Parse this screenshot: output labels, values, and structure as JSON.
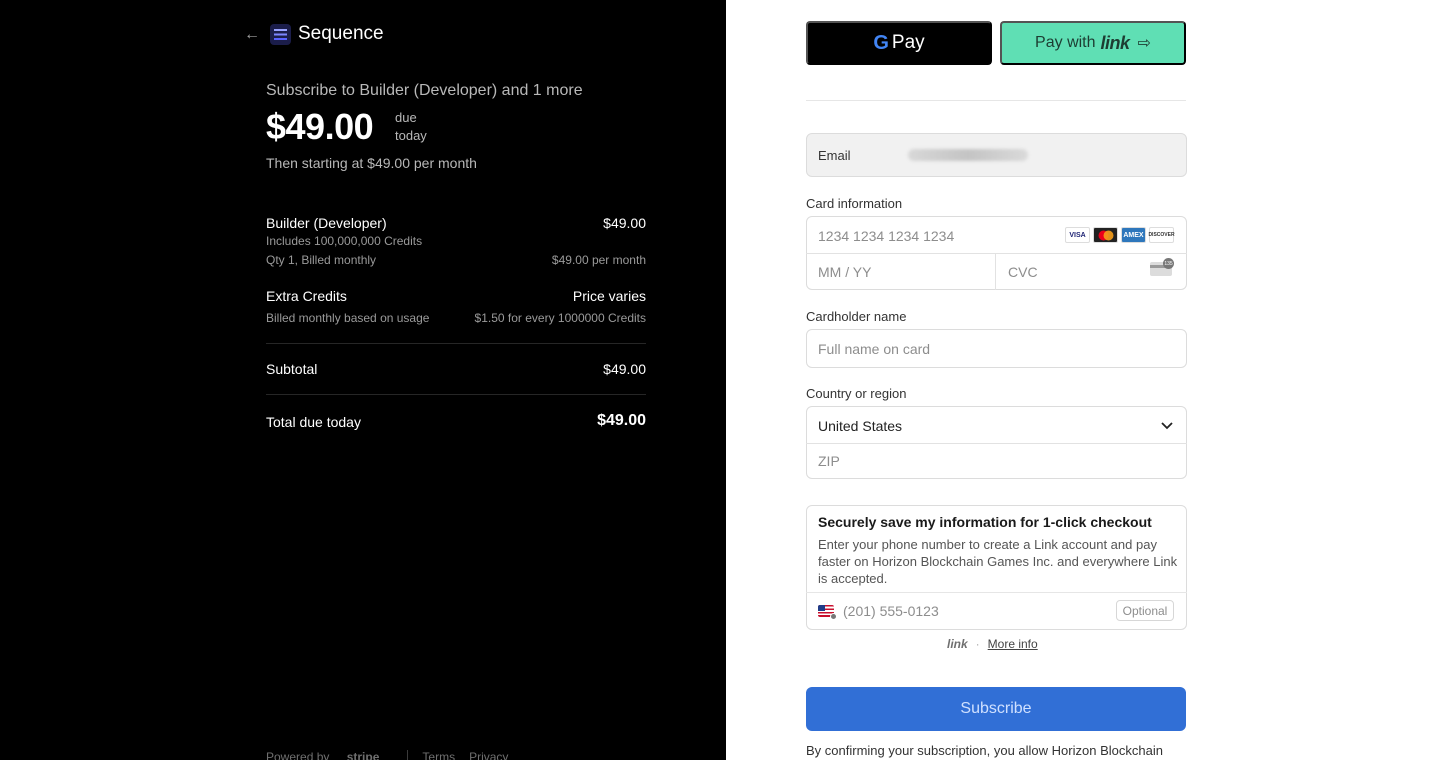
{
  "brand": {
    "name": "Sequence"
  },
  "summary": {
    "subscribe_title": "Subscribe to Builder (Developer) and 1 more",
    "price": "$49.00",
    "due_line1": "due",
    "due_line2": "today",
    "then_text": "Then starting at $49.00 per month"
  },
  "line_items": [
    {
      "name": "Builder (Developer)",
      "price": "$49.00",
      "detail1": "Includes 100,000,000 Credits",
      "detail2": "Qty 1, Billed monthly",
      "detail2_right": "$49.00 per month"
    },
    {
      "name": "Extra Credits",
      "price": "Price varies",
      "detail1": "Billed monthly based on usage",
      "detail1_right": "$1.50 for every 1000000 Credits"
    }
  ],
  "subtotal": {
    "label": "Subtotal",
    "value": "$49.00"
  },
  "total": {
    "label": "Total due today",
    "value": "$49.00"
  },
  "footer": {
    "powered_by": "Powered by",
    "stripe": "stripe",
    "terms": "Terms",
    "privacy": "Privacy"
  },
  "payment": {
    "gpay_label": "Pay",
    "gpay_g": "G",
    "link_pay_prefix": "Pay with",
    "link_word": "link"
  },
  "form": {
    "email_label": "Email",
    "card_label": "Card information",
    "card_number_placeholder": "1234 1234 1234 1234",
    "expiry_placeholder": "MM / YY",
    "cvc_placeholder": "CVC",
    "card_brands": [
      "VISA",
      "",
      "AMEX",
      "DISCOVER"
    ],
    "cvc_badge": "135",
    "cardholder_label": "Cardholder name",
    "cardholder_placeholder": "Full name on card",
    "country_label": "Country or region",
    "country_value": "United States",
    "zip_placeholder": "ZIP"
  },
  "save_info": {
    "title": "Securely save my information for 1-click checkout",
    "description": "Enter your phone number to create a Link account and pay faster on Horizon Blockchain Games Inc. and everywhere Link is accepted.",
    "phone_placeholder": "(201) 555-0123",
    "optional_label": "Optional"
  },
  "link_footer": {
    "link_word": "link",
    "more_info": "More info"
  },
  "subscribe_button": "Subscribe",
  "confirm_text": "By confirming your subscription, you allow Horizon Blockchain",
  "colors": {
    "left_bg": "#000000",
    "link_green": "#5fdfb4",
    "subscribe_blue": "#316fd6"
  }
}
